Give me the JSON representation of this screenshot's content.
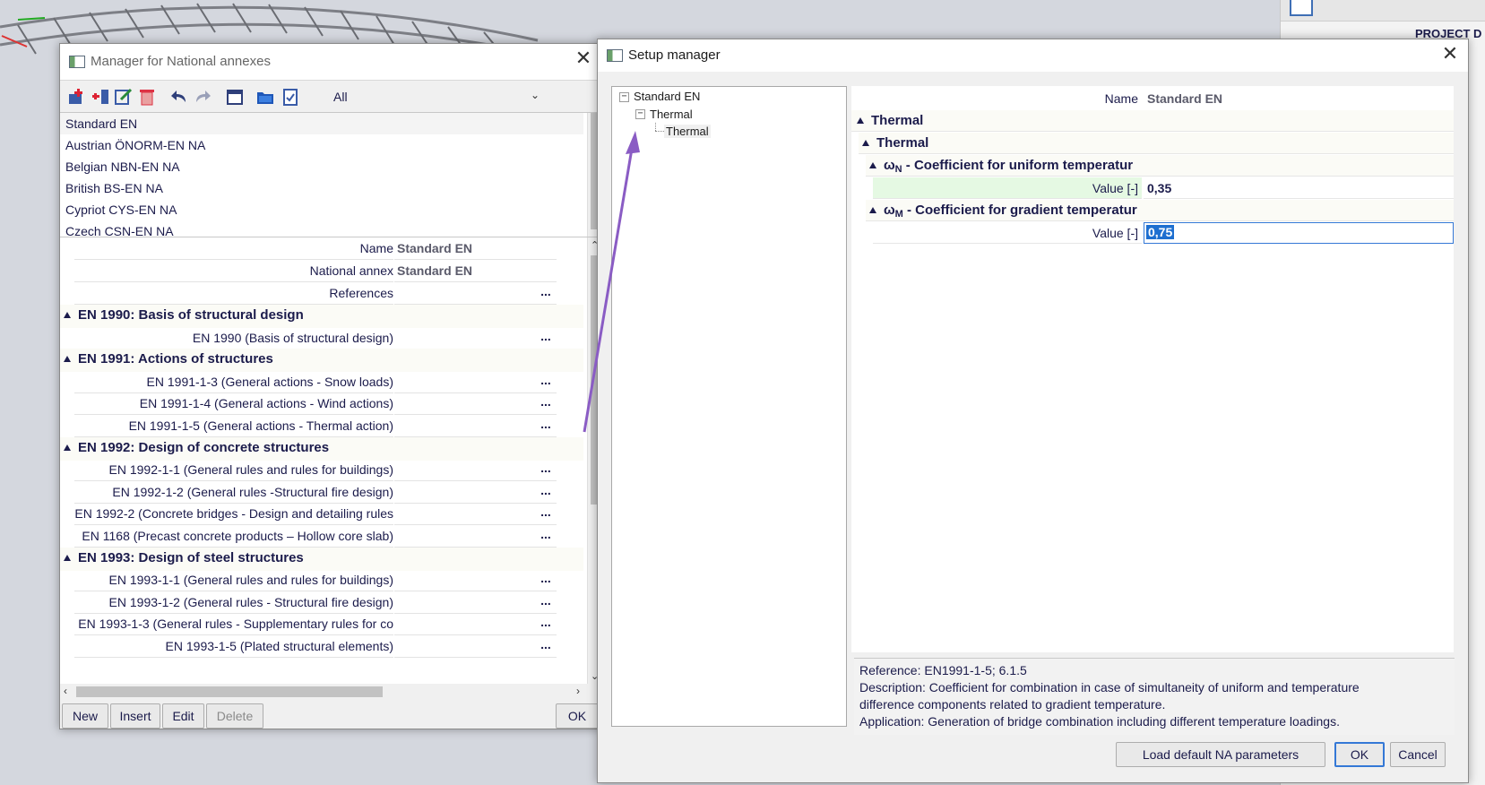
{
  "background": {
    "project_label": "PROJECT D"
  },
  "manager": {
    "title": "Manager for National annexes",
    "filter_value": "All",
    "annexes": [
      "Standard EN",
      "Austrian ÖNORM-EN NA",
      "Belgian NBN-EN NA",
      "British BS-EN NA",
      "Cypriot CYS-EN NA",
      "Czech CSN-EN NA"
    ],
    "properties": {
      "name_label": "Name",
      "name_value": "Standard EN",
      "na_label": "National annex",
      "na_value": "Standard EN",
      "references_label": "References"
    },
    "groups": [
      {
        "title": "EN 1990: Basis of structural design",
        "items": [
          "EN 1990 (Basis of structural design)"
        ]
      },
      {
        "title": "EN 1991: Actions of structures",
        "items": [
          "EN 1991-1-3 (General actions - Snow loads)",
          "EN 1991-1-4 (General actions - Wind actions)",
          "EN 1991-1-5 (General actions - Thermal action)"
        ]
      },
      {
        "title": "EN 1992: Design of concrete structures",
        "items": [
          "EN 1992-1-1 (General rules and rules for buildings)",
          "EN 1992-1-2 (General rules -Structural fire design)",
          "EN 1992-2 (Concrete bridges - Design and detailing rules",
          "EN 1168 (Precast concrete products – Hollow core slab)"
        ]
      },
      {
        "title": "EN 1993: Design of steel structures",
        "items": [
          "EN 1993-1-1 (General rules and rules for buildings)",
          "EN 1993-1-2 (General rules - Structural fire design)",
          "EN 1993-1-3 (General rules - Supplementary rules for co",
          "EN 1993-1-5 (Plated structural elements)"
        ]
      }
    ],
    "ellipsis": "...",
    "buttons": {
      "new": "New",
      "insert": "Insert",
      "edit": "Edit",
      "delete": "Delete",
      "ok": "OK"
    }
  },
  "setup": {
    "title": "Setup manager",
    "tree": {
      "root": "Standard EN",
      "child": "Thermal",
      "leaf": "Thermal"
    },
    "name_label": "Name",
    "name_value": "Standard EN",
    "section_1": "Thermal",
    "section_2": "Thermal",
    "coef_n_symbol": "ω",
    "coef_n_sub": "N",
    "coef_n_label": " - Coefficient for uniform temperatur",
    "coef_n_value_label": "Value [-]",
    "coef_n_value": "0,35",
    "coef_m_symbol": "ω",
    "coef_m_sub": "M",
    "coef_m_label": " - Coefficient for gradient temperatur",
    "coef_m_value_label": "Value [-]",
    "coef_m_value": "0,75",
    "info": {
      "reference": "Reference: EN1991-1-5; 6.1.5",
      "description_1": "Description: Coefficient for combination in case of simultaneity of uniform and temperature",
      "description_2": "difference components related to gradient temperature.",
      "application": "Application: Generation of bridge combination including different temperature loadings."
    },
    "buttons": {
      "load_default": "Load default NA parameters",
      "ok": "OK",
      "cancel": "Cancel"
    }
  },
  "colors": {
    "text": "#1b1b4b",
    "accent": "#3478d6",
    "arrow": "#8a5cc4",
    "green_row": "#e5f9e3",
    "selection": "#1e6fd0"
  }
}
